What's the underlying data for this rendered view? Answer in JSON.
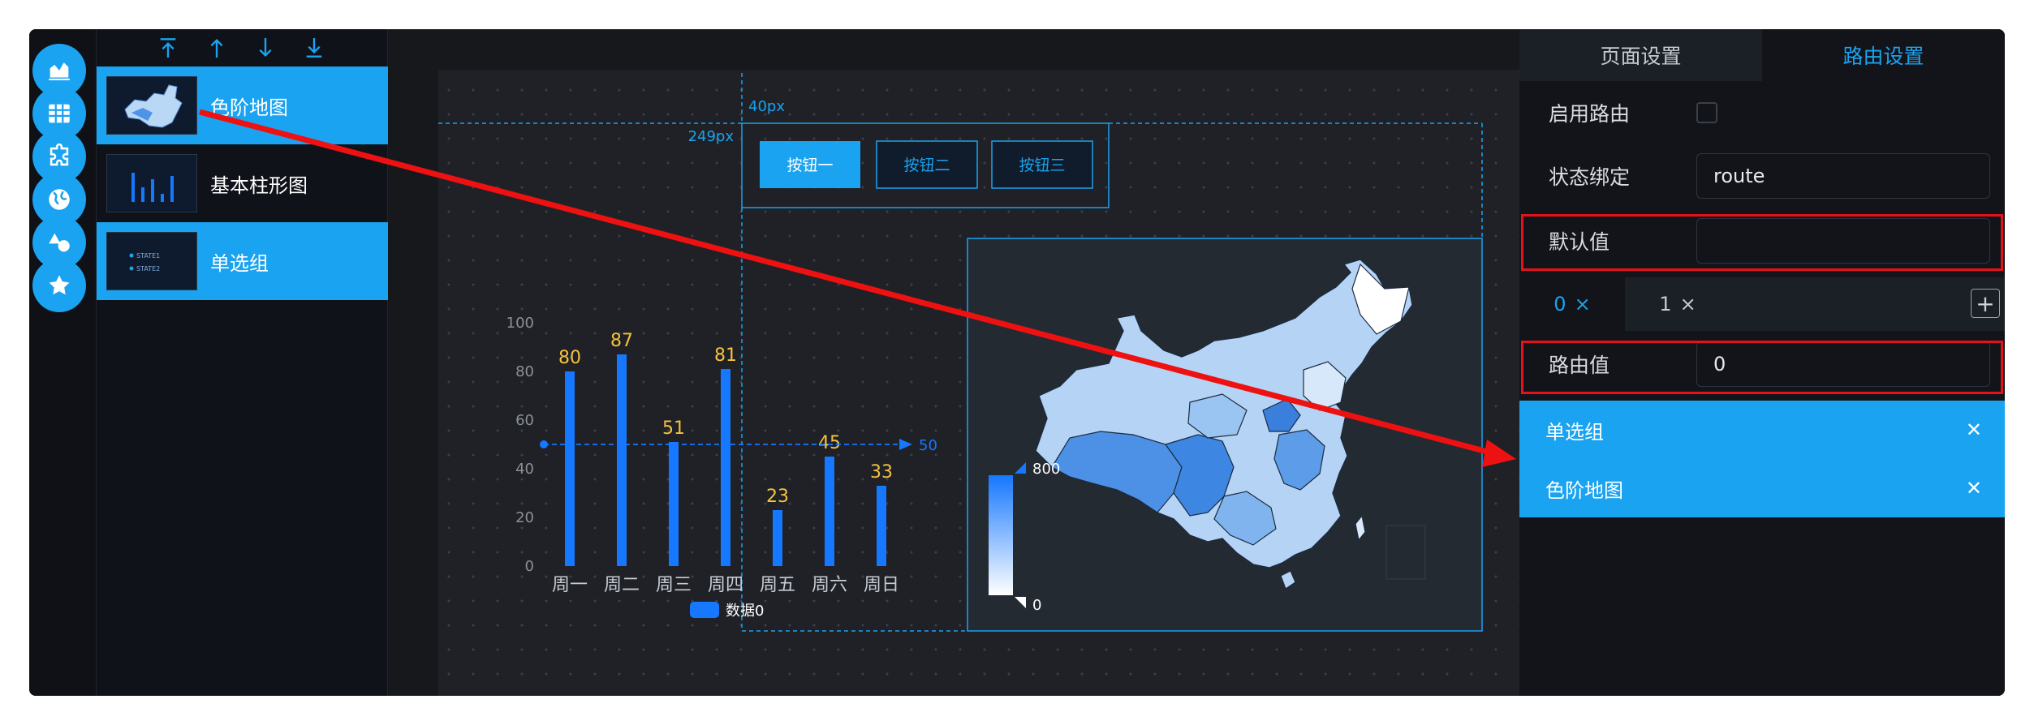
{
  "layers": [
    {
      "label": "色阶地图",
      "active": true
    },
    {
      "label": "基本柱形图",
      "active": false
    },
    {
      "label": "单选组",
      "active": true
    }
  ],
  "radio_thumb": {
    "item1": "STATE1",
    "item2": "STATE2"
  },
  "canvas": {
    "dim_vertical": "40px",
    "dim_horizontal": "249px",
    "buttons": [
      "按钮一",
      "按钮二",
      "按钮三"
    ]
  },
  "chart_data": [
    {
      "type": "bar",
      "categories": [
        "周一",
        "周二",
        "周三",
        "周四",
        "周五",
        "周六",
        "周日"
      ],
      "series": [
        {
          "name": "数据0",
          "values": [
            80,
            87,
            51,
            81,
            23,
            45,
            33
          ]
        }
      ],
      "ylim": [
        0,
        100
      ],
      "yticks": [
        0,
        20,
        40,
        60,
        80,
        100
      ],
      "markline": {
        "value": 50,
        "label": "50"
      },
      "legend": "bottom"
    }
  ],
  "map": {
    "visual_max": "800",
    "visual_min": "0"
  },
  "panel": {
    "tabs": [
      "页面设置",
      "路由设置"
    ],
    "active_tab": 1,
    "enable_route_label": "启用路由",
    "state_bind_label": "状态绑定",
    "state_bind_value": "route",
    "default_value_label": "默认值",
    "default_value": "",
    "subtabs": [
      "0",
      "1"
    ],
    "route_value_label": "路由值",
    "route_value": "0",
    "bound_items": [
      "单选组",
      "色阶地图"
    ]
  },
  "colors": {
    "accent": "#1aa3f0",
    "bar": "#1677ff",
    "value_label": "#f5c23f",
    "highlight": "#e5121c",
    "arrow": "#ee1111"
  }
}
